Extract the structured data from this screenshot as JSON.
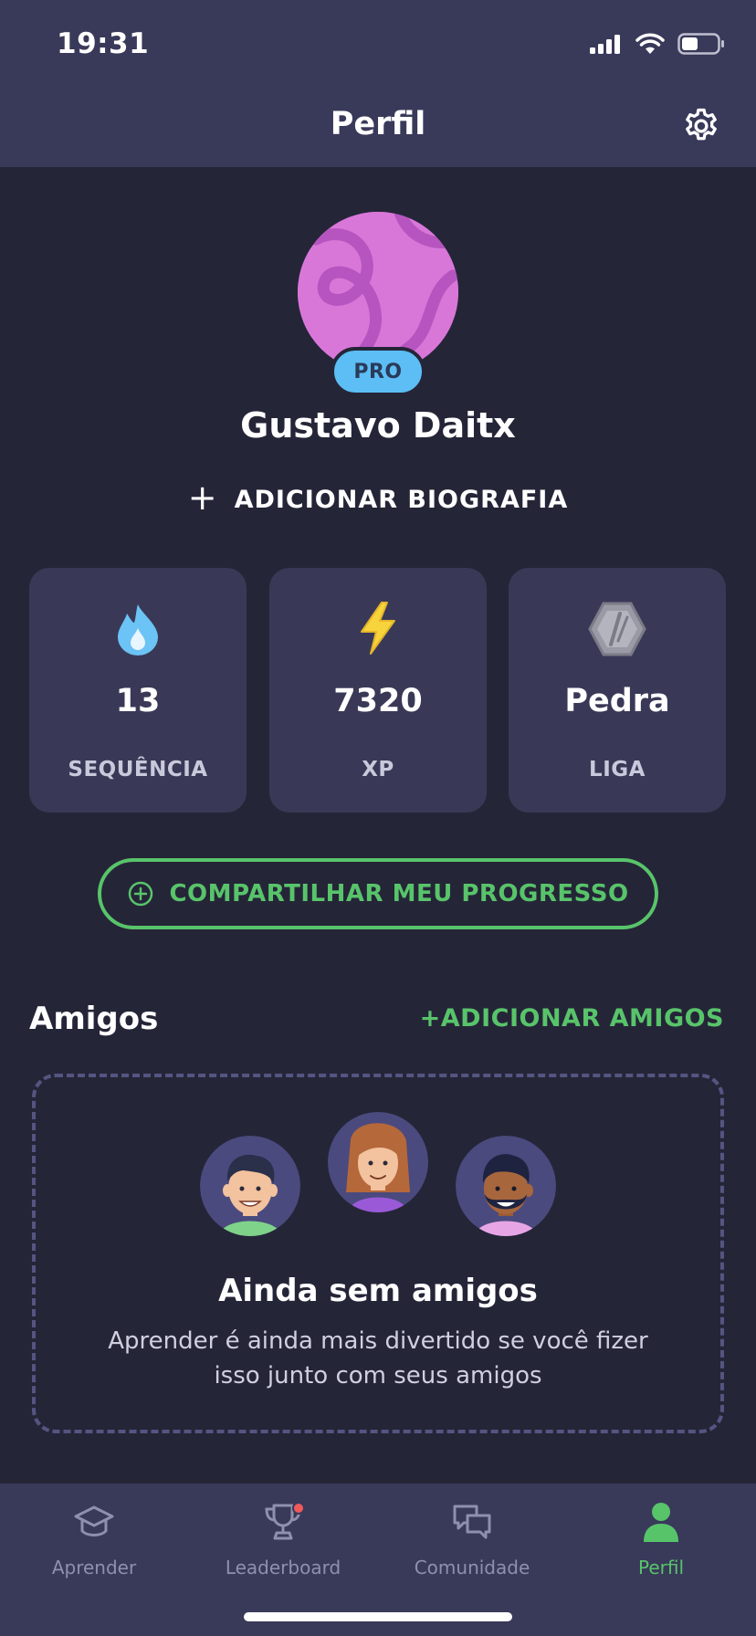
{
  "status_bar": {
    "time": "19:31"
  },
  "header": {
    "title": "Perfil",
    "settings_icon": "gear-icon"
  },
  "profile": {
    "avatar_color": "#d977d9",
    "badge": "PRO",
    "name": "Gustavo Daitx",
    "add_bio_label": "ADICIONAR BIOGRAFIA"
  },
  "stats": [
    {
      "icon": "drop-icon",
      "value": "13",
      "label": "SEQUÊNCIA"
    },
    {
      "icon": "lightning-icon",
      "value": "7320",
      "label": "XP"
    },
    {
      "icon": "hexagon-league-icon",
      "value": "Pedra",
      "label": "LIGA"
    }
  ],
  "share_button": {
    "label": "COMPARTILHAR MEU PROGRESSO"
  },
  "friends": {
    "title": "Amigos",
    "add_label": "+ADICIONAR AMIGOS",
    "empty_title": "Ainda sem amigos",
    "empty_text": "Aprender é ainda mais divertido se você fizer isso junto com seus amigos"
  },
  "tabs": [
    {
      "label": "Aprender",
      "icon": "graduation-cap-icon",
      "active": false
    },
    {
      "label": "Leaderboard",
      "icon": "trophy-icon",
      "active": false,
      "notification": true
    },
    {
      "label": "Comunidade",
      "icon": "chat-bubbles-icon",
      "active": false
    },
    {
      "label": "Perfil",
      "icon": "person-icon",
      "active": true
    }
  ],
  "colors": {
    "background": "#252538",
    "card": "#393957",
    "accent_green": "#58c46a",
    "pro_blue": "#5cbef4"
  }
}
